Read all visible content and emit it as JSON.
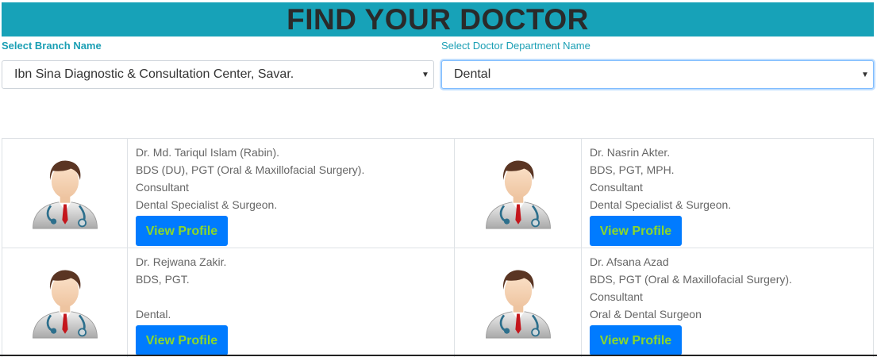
{
  "header": {
    "title": "FIND YOUR DOCTOR"
  },
  "filters": {
    "branch_label": "Select Branch Name",
    "branch_value": "Ibn Sina Diagnostic & Consultation Center, Savar.",
    "department_label": "Select Doctor Department Name",
    "department_value": "Dental"
  },
  "doctors": [
    {
      "name": "Dr. Md. Tariqul Islam (Rabin).",
      "degree": "BDS (DU), PGT (Oral & Maxillofacial Surgery).",
      "designation": "Consultant",
      "specialty": "Dental Specialist & Surgeon.",
      "button": "View Profile"
    },
    {
      "name": "Dr. Nasrin Akter.",
      "degree": "BDS, PGT, MPH.",
      "designation": "Consultant",
      "specialty": "Dental Specialist & Surgeon.",
      "button": "View Profile"
    },
    {
      "name": "Dr. Rejwana Zakir.",
      "degree": "BDS, PGT.",
      "designation": "",
      "specialty": "Dental.",
      "button": "View Profile"
    },
    {
      "name": "Dr. Afsana Azad",
      "degree": "BDS, PGT (Oral & Maxillofacial Surgery).",
      "designation": "Consultant",
      "specialty": "Oral & Dental Surgeon",
      "button": "View Profile"
    }
  ],
  "icons": {
    "avatar": "doctor-avatar-icon",
    "caret": "caret-down-icon"
  },
  "colors": {
    "banner": "#17a2b8",
    "button": "#007bff",
    "button_text": "#8bd82a",
    "label": "#1a9fb4"
  }
}
